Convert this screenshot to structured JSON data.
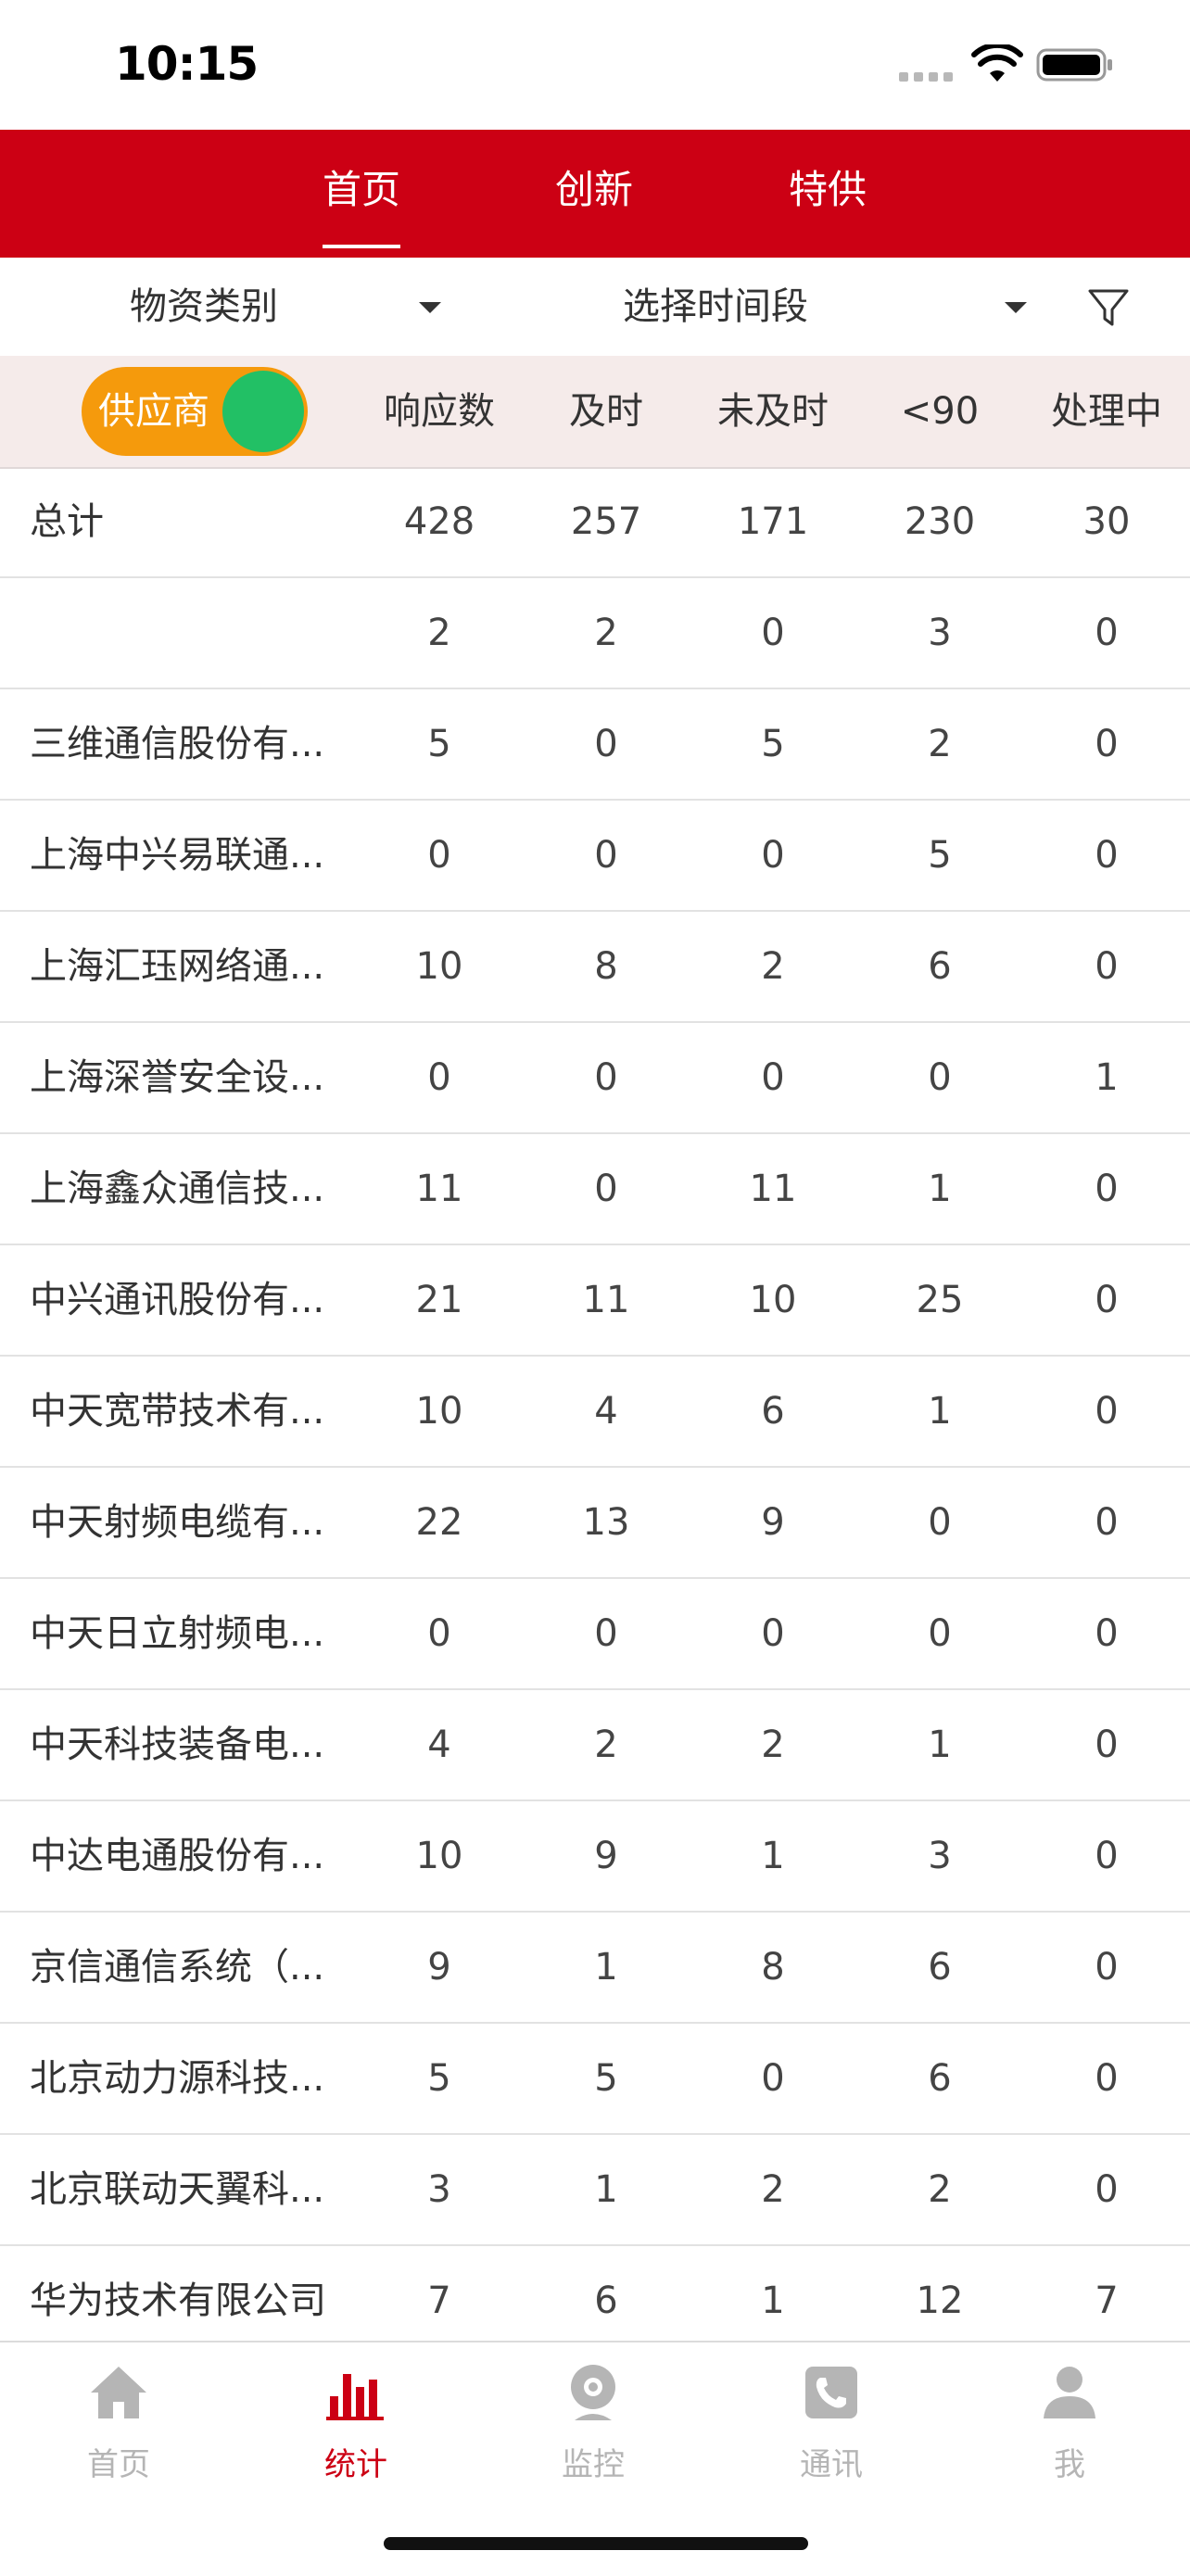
{
  "status_bar": {
    "time": "10:15"
  },
  "top_tabs": [
    {
      "label": "首页",
      "active": true
    },
    {
      "label": "创新",
      "active": false
    },
    {
      "label": "特供",
      "active": false
    }
  ],
  "filters": {
    "category": "物资类别",
    "period": "选择时间段",
    "filter_icon": "filter-icon"
  },
  "table": {
    "toggle_label": "供应商",
    "toggle_on": true,
    "columns": [
      "响应数",
      "及时",
      "未及时",
      "<90",
      "处理中"
    ],
    "rows": [
      {
        "name": "总计",
        "values": [
          "428",
          "257",
          "171",
          "230",
          "30"
        ]
      },
      {
        "name": "",
        "values": [
          "2",
          "2",
          "0",
          "3",
          "0"
        ]
      },
      {
        "name": "三维通信股份有...",
        "values": [
          "5",
          "0",
          "5",
          "2",
          "0"
        ]
      },
      {
        "name": "上海中兴易联通...",
        "values": [
          "0",
          "0",
          "0",
          "5",
          "0"
        ]
      },
      {
        "name": "上海汇珏网络通...",
        "values": [
          "10",
          "8",
          "2",
          "6",
          "0"
        ]
      },
      {
        "name": "上海深誉安全设...",
        "values": [
          "0",
          "0",
          "0",
          "0",
          "1"
        ]
      },
      {
        "name": "上海鑫众通信技...",
        "values": [
          "11",
          "0",
          "11",
          "1",
          "0"
        ]
      },
      {
        "name": "中兴通讯股份有...",
        "values": [
          "21",
          "11",
          "10",
          "25",
          "0"
        ]
      },
      {
        "name": "中天宽带技术有...",
        "values": [
          "10",
          "4",
          "6",
          "1",
          "0"
        ]
      },
      {
        "name": "中天射频电缆有...",
        "values": [
          "22",
          "13",
          "9",
          "0",
          "0"
        ]
      },
      {
        "name": "中天日立射频电...",
        "values": [
          "0",
          "0",
          "0",
          "0",
          "0"
        ]
      },
      {
        "name": "中天科技装备电...",
        "values": [
          "4",
          "2",
          "2",
          "1",
          "0"
        ]
      },
      {
        "name": "中达电通股份有...",
        "values": [
          "10",
          "9",
          "1",
          "3",
          "0"
        ]
      },
      {
        "name": "京信通信系统（...",
        "values": [
          "9",
          "1",
          "8",
          "6",
          "0"
        ]
      },
      {
        "name": "北京动力源科技...",
        "values": [
          "5",
          "5",
          "0",
          "6",
          "0"
        ]
      },
      {
        "name": "北京联动天翼科...",
        "values": [
          "3",
          "1",
          "2",
          "2",
          "0"
        ]
      },
      {
        "name": "华为技术有限公司",
        "values": [
          "7",
          "6",
          "1",
          "12",
          "7"
        ]
      }
    ]
  },
  "bottom_tabs": [
    {
      "label": "首页",
      "icon": "home-icon",
      "active": false
    },
    {
      "label": "统计",
      "icon": "bar-chart-icon",
      "active": true
    },
    {
      "label": "监控",
      "icon": "camera-icon",
      "active": false
    },
    {
      "label": "通讯",
      "icon": "phone-icon",
      "active": false
    },
    {
      "label": "我",
      "icon": "user-icon",
      "active": false
    }
  ],
  "colors": {
    "brand_red": "#cc0014",
    "toggle_orange": "#f59a0c",
    "toggle_green": "#22c065",
    "header_bg": "#f5ebea"
  }
}
